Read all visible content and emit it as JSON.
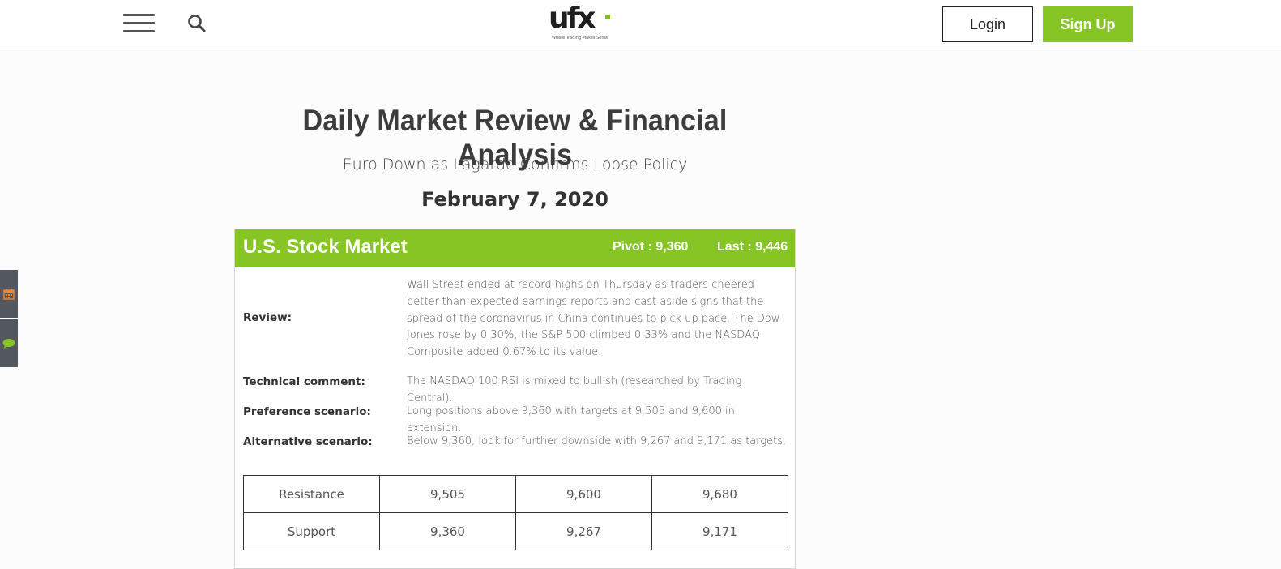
{
  "header": {
    "logo_text": "ufx",
    "logo_tagline": "Where Trading Makes Sense",
    "login_label": "Login",
    "signup_label": "Sign Up",
    "accent_color": "#86c524"
  },
  "page": {
    "title": "Daily Market Review & Financial Analysis",
    "subtitle": "Euro Down as Lagarde Confirms Loose Policy",
    "date": "February 7, 2020"
  },
  "side_tabs": [
    {
      "icon": "calendar-icon",
      "color": "#e8893a"
    },
    {
      "icon": "chat-icon",
      "color": "#86c524"
    }
  ],
  "market": {
    "title": "U.S. Stock Market",
    "pivot": "Pivot : 9,360",
    "last": "Last : 9,446",
    "rows": [
      {
        "label": "Review:",
        "text": "Wall Street ended at record highs on Thursday as traders cheered better-than-expected earnings reports and cast aside signs that the spread of the coronavirus in China continues to pick up pace. The Dow Jones rose by 0.30%, the S&P 500 climbed 0.33% and the NASDAQ Composite added 0.67% to its value."
      },
      {
        "label": "Technical comment:",
        "text": "The NASDAQ 100 RSI is mixed to bullish (researched by Trading Central)."
      },
      {
        "label": "Preference scenario:",
        "text": "Long positions above 9,360 with targets at 9,505 and 9,600 in extension."
      },
      {
        "label": "Alternative scenario:",
        "text": "Below 9,360, look for further downside with 9,267 and 9,171 as targets."
      }
    ],
    "levels": [
      [
        "Resistance",
        "9,505",
        "9,600",
        "9,680"
      ],
      [
        "Support",
        "9,360",
        "9,267",
        "9,171"
      ]
    ]
  }
}
